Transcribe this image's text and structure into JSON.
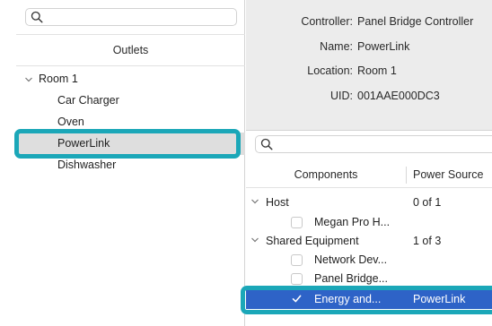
{
  "left": {
    "search": {
      "placeholder": ""
    },
    "header": "Outlets",
    "tree": {
      "group": {
        "label": "Room 1",
        "expanded": true
      },
      "items": [
        "Car Charger",
        "Oven",
        "PowerLink",
        "Dishwasher"
      ],
      "selected": "PowerLink"
    }
  },
  "details": {
    "controller_label": "Controller:",
    "controller_value": "Panel Bridge Controller",
    "name_label": "Name:",
    "name_value": "PowerLink",
    "location_label": "Location:",
    "location_value": "Room 1",
    "uid_label": "UID:",
    "uid_value": "001AAE000DC3"
  },
  "components": {
    "search": {
      "placeholder": ""
    },
    "headers": {
      "components": "Components",
      "power_source": "Power Source"
    },
    "groups": [
      {
        "name": "Host",
        "source": "0 of 1",
        "items": [
          {
            "name": "Megan Pro H...",
            "checked": false,
            "source": ""
          }
        ]
      },
      {
        "name": "Shared Equipment",
        "source": "1 of 3",
        "items": [
          {
            "name": "Network Dev...",
            "checked": false,
            "source": ""
          },
          {
            "name": "Panel Bridge...",
            "checked": false,
            "source": ""
          },
          {
            "name": "Energy and...",
            "checked": true,
            "source": "PowerLink"
          }
        ]
      }
    ]
  },
  "colors": {
    "accent_highlight": "#1ba7b8",
    "selection_blue": "#2e63c7",
    "selected_row_gray": "#dedede"
  }
}
